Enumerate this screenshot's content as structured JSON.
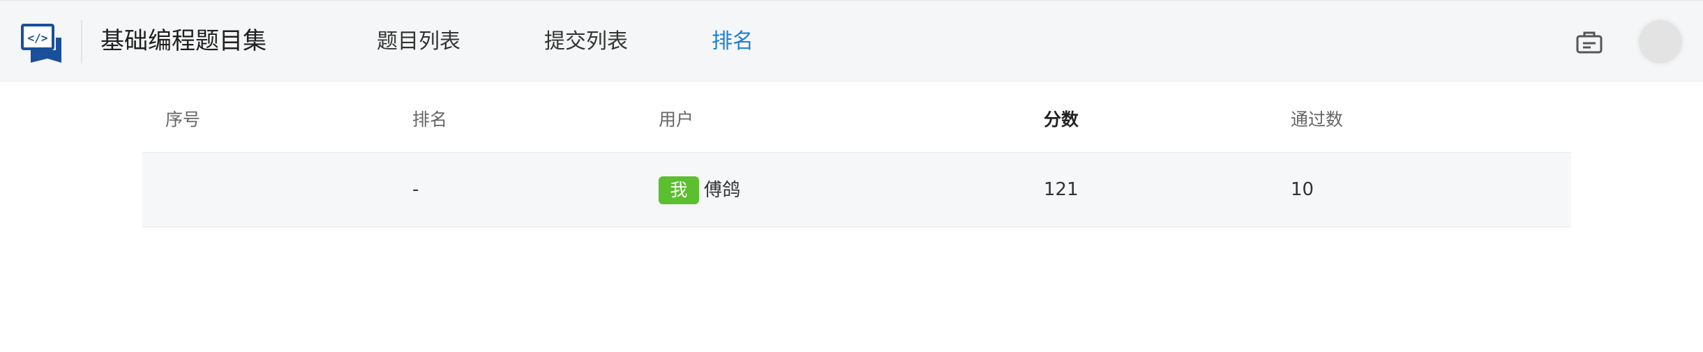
{
  "header": {
    "app_title": "基础编程题目集",
    "nav": [
      {
        "label": "题目列表",
        "active": false
      },
      {
        "label": "提交列表",
        "active": false
      },
      {
        "label": "排名",
        "active": true
      }
    ],
    "icons": {
      "logo": "code-screen-logo",
      "cart": "briefcase-icon",
      "avatar": "user-avatar"
    },
    "accent_color": "#1e7fd6"
  },
  "ranking_table": {
    "columns": [
      "序号",
      "排名",
      "用户",
      "分数",
      "通过数"
    ],
    "rows": [
      {
        "index": "",
        "rank": "-",
        "me_badge": "我",
        "user": "傅鸽",
        "score": "121",
        "passed": "10"
      }
    ],
    "badge_color": "#5bbf2f"
  }
}
